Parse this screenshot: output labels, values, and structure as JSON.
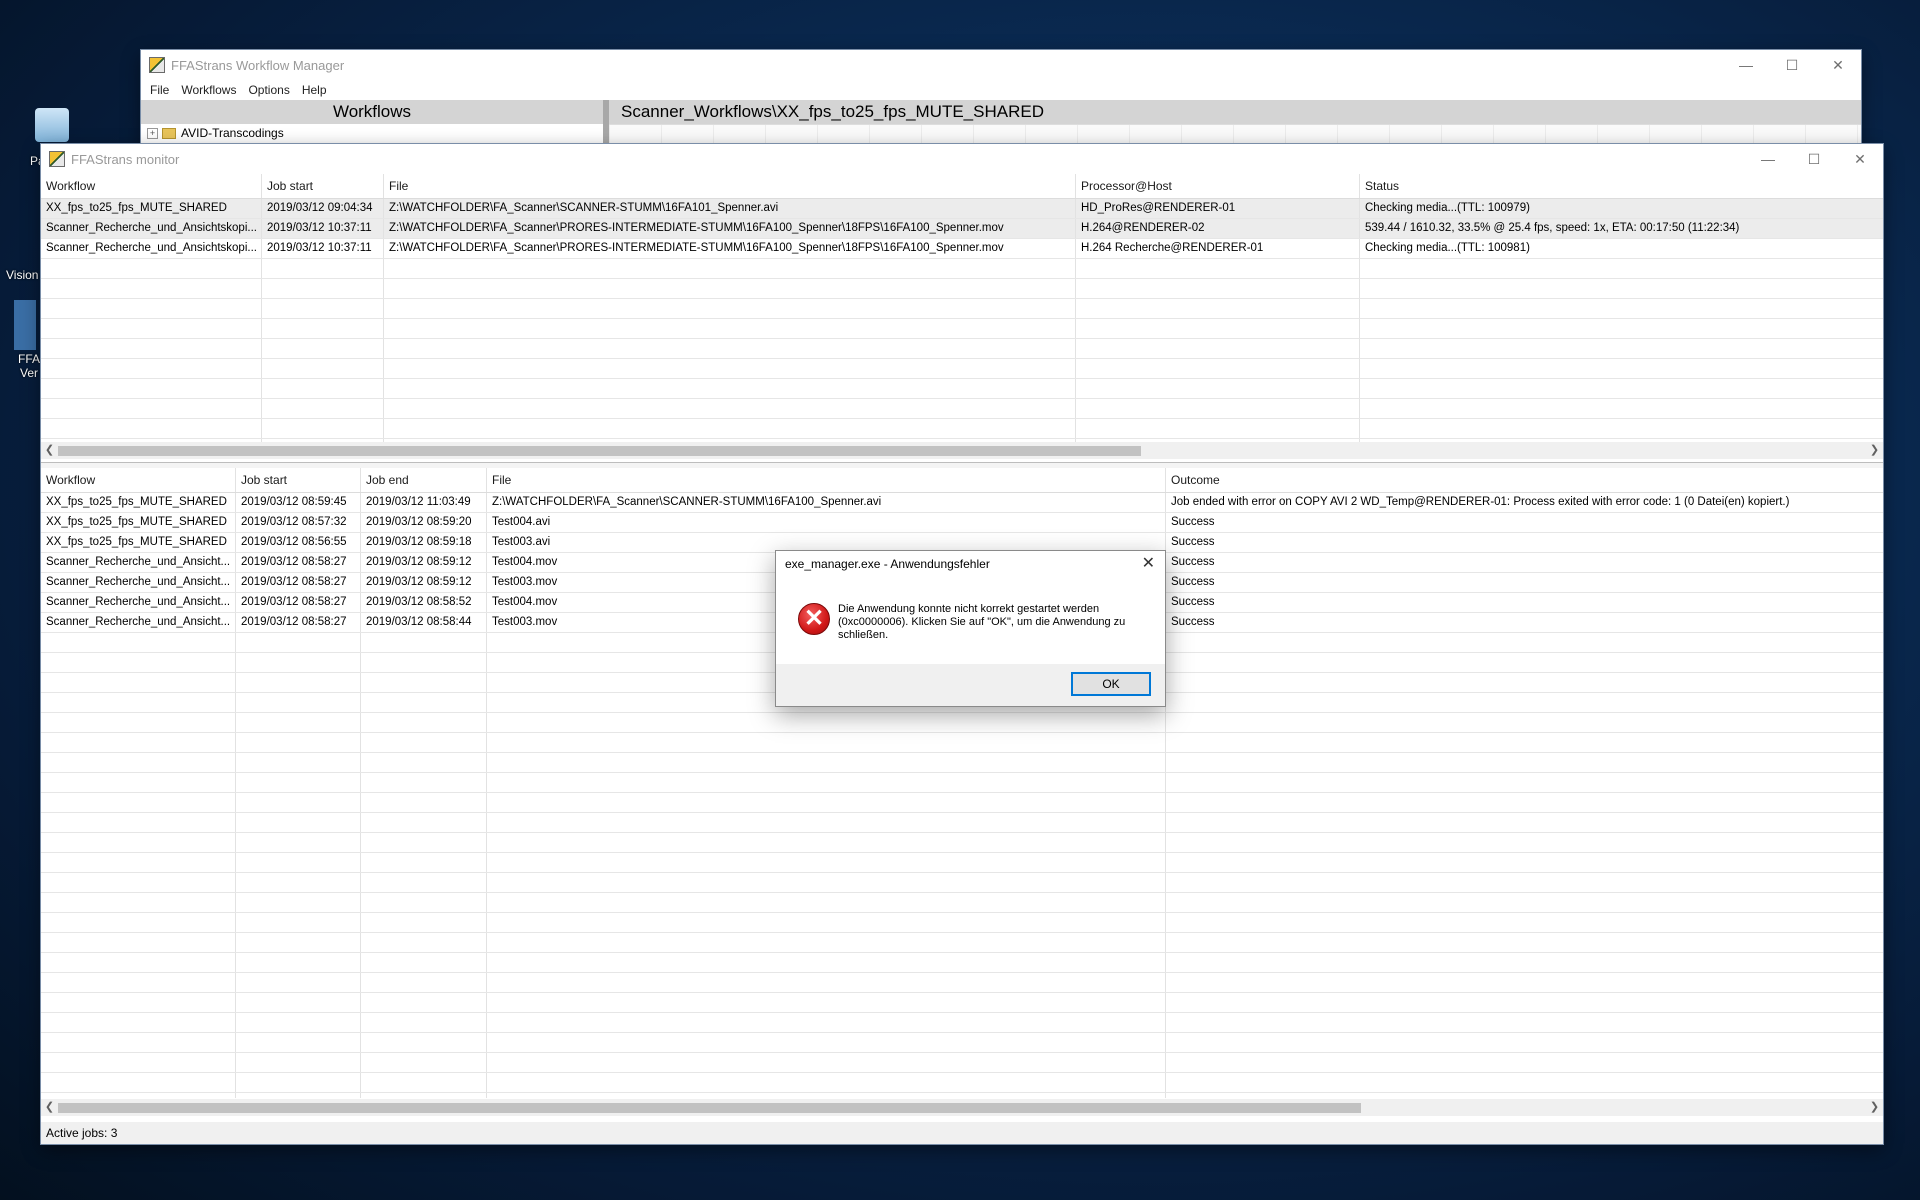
{
  "desktop": {
    "icon1_label": "Pa",
    "icon2_label": "Vision",
    "icon3_label": "FFA\nVer"
  },
  "manager": {
    "title": "FFAStrans Workflow Manager",
    "menu": [
      "File",
      "Workflows",
      "Options",
      "Help"
    ],
    "left_header": "Workflows",
    "tree_item": "AVID-Transcodings",
    "right_header": "Scanner_Workflows\\XX_fps_to25_fps_MUTE_SHARED"
  },
  "monitor": {
    "title": "FFAStrans monitor",
    "active_jobs": {
      "columns": [
        "Workflow",
        "Job start",
        "File",
        "Processor@Host",
        "Status"
      ],
      "rows": [
        [
          "XX_fps_to25_fps_MUTE_SHARED",
          "2019/03/12 09:04:34",
          "Z:\\WATCHFOLDER\\FA_Scanner\\SCANNER-STUMM\\16FA101_Spenner.avi",
          "HD_ProRes@RENDERER-01",
          "Checking media...(TTL: 100979)"
        ],
        [
          "Scanner_Recherche_und_Ansichtskopi...",
          "2019/03/12 10:37:11",
          "Z:\\WATCHFOLDER\\FA_Scanner\\PRORES-INTERMEDIATE-STUMM\\16FA100_Spenner\\18FPS\\16FA100_Spenner.mov",
          "H.264@RENDERER-02",
          "539.44 / 1610.32, 33.5% @ 25.4 fps, speed: 1x, ETA: 00:17:50 (11:22:34)"
        ],
        [
          "Scanner_Recherche_und_Ansichtskopi...",
          "2019/03/12 10:37:11",
          "Z:\\WATCHFOLDER\\FA_Scanner\\PRORES-INTERMEDIATE-STUMM\\16FA100_Spenner\\18FPS\\16FA100_Spenner.mov",
          "H.264 Recherche@RENDERER-01",
          "Checking media...(TTL: 100981)"
        ]
      ]
    },
    "history": {
      "columns": [
        "Workflow",
        "Job start",
        "Job end",
        "File",
        "Outcome"
      ],
      "rows": [
        [
          "XX_fps_to25_fps_MUTE_SHARED",
          "2019/03/12 08:59:45",
          "2019/03/12 11:03:49",
          "Z:\\WATCHFOLDER\\FA_Scanner\\SCANNER-STUMM\\16FA100_Spenner.avi",
          "Job ended with error on COPY AVI 2 WD_Temp@RENDERER-01: Process exited with error code: 1 (0 Datei(en) kopiert.)"
        ],
        [
          "XX_fps_to25_fps_MUTE_SHARED",
          "2019/03/12 08:57:32",
          "2019/03/12 08:59:20",
          "Test004.avi",
          "Success"
        ],
        [
          "XX_fps_to25_fps_MUTE_SHARED",
          "2019/03/12 08:56:55",
          "2019/03/12 08:59:18",
          "Test003.avi",
          "Success"
        ],
        [
          "Scanner_Recherche_und_Ansicht...",
          "2019/03/12 08:58:27",
          "2019/03/12 08:59:12",
          "Test004.mov",
          "Success"
        ],
        [
          "Scanner_Recherche_und_Ansicht...",
          "2019/03/12 08:58:27",
          "2019/03/12 08:59:12",
          "Test003.mov",
          "Success"
        ],
        [
          "Scanner_Recherche_und_Ansicht...",
          "2019/03/12 08:58:27",
          "2019/03/12 08:58:52",
          "Test004.mov",
          "Success"
        ],
        [
          "Scanner_Recherche_und_Ansicht...",
          "2019/03/12 08:58:27",
          "2019/03/12 08:58:44",
          "Test003.mov",
          "Success"
        ]
      ]
    },
    "status": "Active jobs: 3"
  },
  "dialog": {
    "title": "exe_manager.exe - Anwendungsfehler",
    "message": "Die Anwendung konnte nicht korrekt gestartet werden (0xc0000006). Klicken Sie auf \"OK\", um die Anwendung zu schließen.",
    "ok_label": "OK"
  }
}
